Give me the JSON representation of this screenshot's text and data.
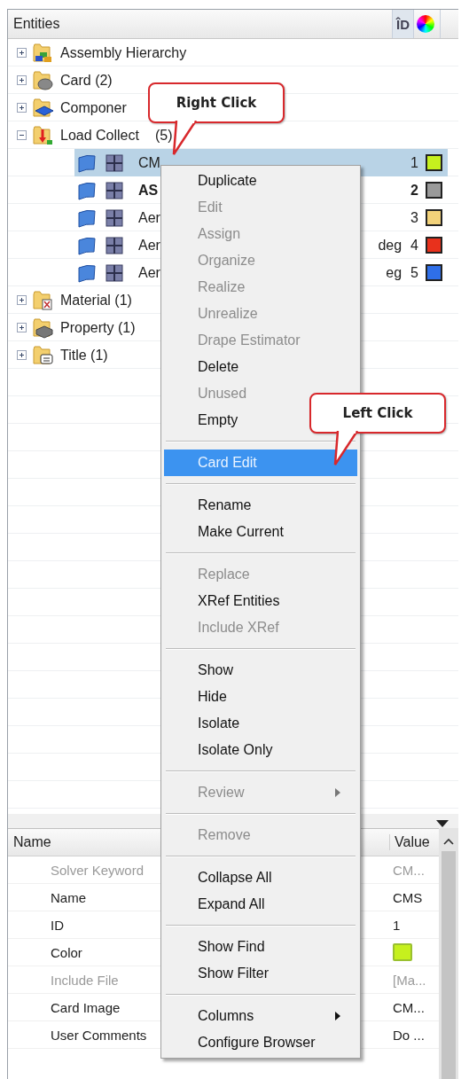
{
  "entities_panel": {
    "title": "Entities",
    "id_column": "ÎD"
  },
  "tree": {
    "items": [
      {
        "kind": "assembly",
        "label": "Assembly Hierarchy",
        "expanded": false
      },
      {
        "kind": "card",
        "label": "Card (2)",
        "expanded": false
      },
      {
        "kind": "component",
        "label": "Componer",
        "expanded": false
      },
      {
        "kind": "load",
        "label": "Load Collect",
        "trailing": "(5)",
        "expanded": true,
        "children": [
          {
            "label": "CM",
            "id": "1",
            "color": "#c6f01e",
            "selected": true,
            "current": false
          },
          {
            "label": "AS",
            "id": "2",
            "color": "#9a9a9a",
            "selected": false,
            "current": true
          },
          {
            "label": "Aer",
            "id": "3",
            "color": "#f2d27a",
            "selected": false,
            "current": false
          },
          {
            "label": "Aer",
            "trailing": "deg",
            "id": "4",
            "color": "#e8311c",
            "selected": false,
            "current": false
          },
          {
            "label": "Aer",
            "trailing": "eg",
            "id": "5",
            "color": "#2f6fe8",
            "selected": false,
            "current": false
          }
        ]
      },
      {
        "kind": "material",
        "label": "Material (1)",
        "expanded": false
      },
      {
        "kind": "property",
        "label": "Property (1)",
        "expanded": false
      },
      {
        "kind": "title",
        "label": "Title (1)",
        "expanded": false
      }
    ]
  },
  "properties": {
    "columns": [
      "Name",
      "Value"
    ],
    "rows": [
      {
        "kind": "text",
        "name": "Solver Keyword",
        "value": "CM...",
        "disabled": true
      },
      {
        "kind": "text",
        "name": "Name",
        "value": "CMS",
        "disabled": false
      },
      {
        "kind": "text",
        "name": "ID",
        "value": "1",
        "disabled": false
      },
      {
        "kind": "color",
        "name": "Color",
        "color": "#c6f01e",
        "disabled": false
      },
      {
        "kind": "text",
        "name": "Include File",
        "value": "[Ma...",
        "disabled": true
      },
      {
        "kind": "text",
        "name": "Card Image",
        "value": "CM...",
        "disabled": false
      },
      {
        "kind": "text",
        "name": "User Comments",
        "value": "Do ...",
        "disabled": false
      }
    ]
  },
  "context_menu": {
    "items": [
      {
        "kind": "item",
        "label": "Duplicate",
        "disabled": false,
        "selected": false
      },
      {
        "kind": "item",
        "label": "Edit",
        "disabled": true,
        "selected": false
      },
      {
        "kind": "item",
        "label": "Assign",
        "disabled": true,
        "selected": false
      },
      {
        "kind": "item",
        "label": "Organize",
        "disabled": true,
        "selected": false
      },
      {
        "kind": "item",
        "label": "Realize",
        "disabled": true,
        "selected": false
      },
      {
        "kind": "item",
        "label": "Unrealize",
        "disabled": true,
        "selected": false
      },
      {
        "kind": "item",
        "label": "Drape Estimator",
        "disabled": true,
        "selected": false
      },
      {
        "kind": "item",
        "label": "Delete",
        "disabled": false,
        "selected": false
      },
      {
        "kind": "item",
        "label": "Unused",
        "disabled": true,
        "selected": false
      },
      {
        "kind": "item",
        "label": "Empty",
        "disabled": false,
        "selected": false
      },
      {
        "kind": "separator"
      },
      {
        "kind": "item",
        "label": "Card Edit",
        "disabled": false,
        "selected": true
      },
      {
        "kind": "separator"
      },
      {
        "kind": "item",
        "label": "Rename",
        "disabled": false,
        "selected": false
      },
      {
        "kind": "item",
        "label": "Make Current",
        "disabled": false,
        "selected": false
      },
      {
        "kind": "separator"
      },
      {
        "kind": "item",
        "label": "Replace",
        "disabled": true,
        "selected": false
      },
      {
        "kind": "item",
        "label": "XRef Entities",
        "disabled": false,
        "selected": false
      },
      {
        "kind": "item",
        "label": "Include XRef",
        "disabled": true,
        "selected": false
      },
      {
        "kind": "separator"
      },
      {
        "kind": "item",
        "label": "Show",
        "disabled": false,
        "selected": false
      },
      {
        "kind": "item",
        "label": "Hide",
        "disabled": false,
        "selected": false
      },
      {
        "kind": "item",
        "label": "Isolate",
        "disabled": false,
        "selected": false
      },
      {
        "kind": "item",
        "label": "Isolate Only",
        "disabled": false,
        "selected": false
      },
      {
        "kind": "separator"
      },
      {
        "kind": "submenu",
        "label": "Review",
        "disabled": true,
        "selected": false
      },
      {
        "kind": "separator"
      },
      {
        "kind": "item",
        "label": "Remove",
        "disabled": true,
        "selected": false
      },
      {
        "kind": "separator"
      },
      {
        "kind": "item",
        "label": "Collapse All",
        "disabled": false,
        "selected": false
      },
      {
        "kind": "item",
        "label": "Expand All",
        "disabled": false,
        "selected": false
      },
      {
        "kind": "separator"
      },
      {
        "kind": "item",
        "label": "Show Find",
        "disabled": false,
        "selected": false
      },
      {
        "kind": "item",
        "label": "Show Filter",
        "disabled": false,
        "selected": false
      },
      {
        "kind": "separator"
      },
      {
        "kind": "submenu",
        "label": "Columns",
        "disabled": false,
        "selected": false
      },
      {
        "kind": "item",
        "label": "Configure Browser",
        "disabled": false,
        "selected": false
      }
    ]
  },
  "callouts": [
    {
      "kind": "top",
      "text": "Right Click"
    },
    {
      "kind": "middle",
      "text": "Left Click"
    }
  ]
}
